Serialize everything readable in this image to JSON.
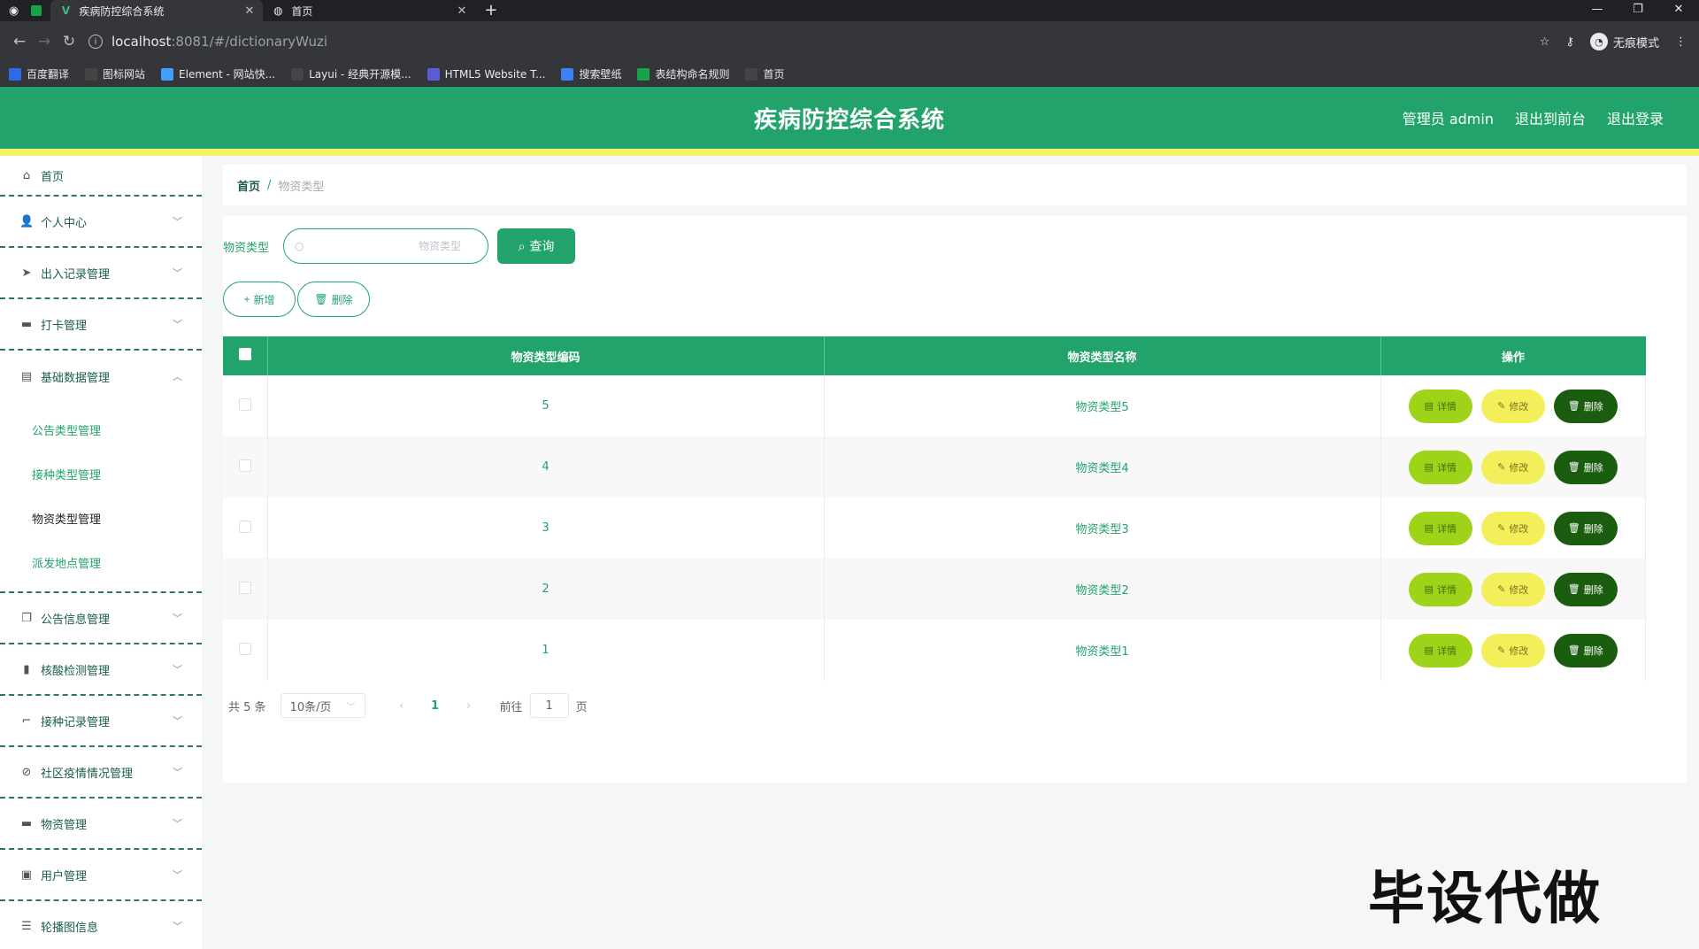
{
  "browser": {
    "tabs": [
      {
        "title": "疾病防控综合系统",
        "active": true
      },
      {
        "title": "首页",
        "active": false
      }
    ],
    "url_host": "localhost",
    "url_path": ":8081/#/dictionaryWuzi",
    "incognito_label": "无痕模式",
    "bookmarks": [
      {
        "label": "百度翻译",
        "color": "#2b6de8"
      },
      {
        "label": "图标网站",
        "color": "#444"
      },
      {
        "label": "Element - 网站快...",
        "color": "#409eff"
      },
      {
        "label": "Layui - 经典开源模...",
        "color": "#444"
      },
      {
        "label": "HTML5 Website T...",
        "color": "#5b5bd6"
      },
      {
        "label": "搜索壁纸",
        "color": "#3b82f6"
      },
      {
        "label": "表结构命名规则",
        "color": "#16a34a"
      },
      {
        "label": "首页",
        "color": "#444"
      }
    ]
  },
  "header": {
    "title": "疾病防控综合系统",
    "user": "管理员 admin",
    "to_front": "退出到前台",
    "logout": "退出登录",
    "accent": "#22a36b",
    "stripe": "#f4f368"
  },
  "sidebar": {
    "home": "首页",
    "items_before": [
      {
        "label": "个人中心",
        "icon": "user-icon"
      },
      {
        "label": "出入记录管理",
        "icon": "send-icon"
      },
      {
        "label": "打卡管理",
        "icon": "briefcase-icon"
      }
    ],
    "expanded": {
      "label": "基础数据管理",
      "icon": "clipboard-icon"
    },
    "sub_items": [
      {
        "label": "公告类型管理",
        "active": false
      },
      {
        "label": "接种类型管理",
        "active": false
      },
      {
        "label": "物资类型管理",
        "active": true
      },
      {
        "label": "派发地点管理",
        "active": false
      }
    ],
    "items_after": [
      {
        "label": "公告信息管理",
        "icon": "copy-icon"
      },
      {
        "label": "核酸检测管理",
        "icon": "bar-chart-icon"
      },
      {
        "label": "接种记录管理",
        "icon": "crop-icon"
      },
      {
        "label": "社区疫情情况管理",
        "icon": "compass-icon"
      },
      {
        "label": "物资管理",
        "icon": "box-icon"
      },
      {
        "label": "用户管理",
        "icon": "id-card-icon"
      },
      {
        "label": "轮播图信息",
        "icon": "sliders-icon"
      }
    ]
  },
  "breadcrumb": {
    "home": "首页",
    "sep": "/",
    "current": "物资类型"
  },
  "search": {
    "label": "物资类型",
    "placeholder": "物资类型",
    "value": "",
    "button": "查询"
  },
  "actions": {
    "add": "新增",
    "delete": "删除"
  },
  "table": {
    "columns": [
      "物资类型编码",
      "物资类型名称",
      "操作"
    ],
    "rows": [
      {
        "code": "5",
        "name": "物资类型5"
      },
      {
        "code": "4",
        "name": "物资类型4"
      },
      {
        "code": "3",
        "name": "物资类型3"
      },
      {
        "code": "2",
        "name": "物资类型2"
      },
      {
        "code": "1",
        "name": "物资类型1"
      }
    ],
    "row_actions": {
      "detail": "详情",
      "edit": "修改",
      "delete": "删除"
    }
  },
  "pagination": {
    "total": "共 5 条",
    "page_size": "10条/页",
    "current_page": "1",
    "goto_label": "前往",
    "goto_value": "1",
    "page_suffix": "页"
  },
  "watermark": "毕设代做"
}
